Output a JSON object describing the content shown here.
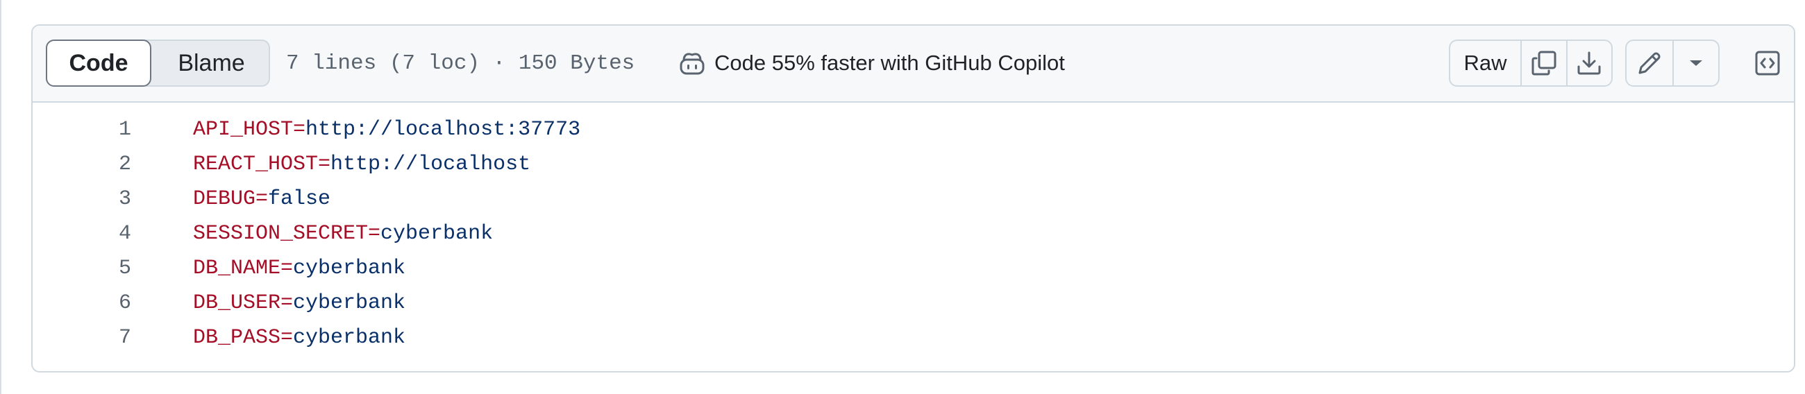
{
  "header": {
    "code_tab": "Code",
    "blame_tab": "Blame",
    "file_info": "7 lines (7 loc) · 150 Bytes",
    "copilot_promo": "Code 55% faster with GitHub Copilot",
    "raw_label": "Raw",
    "icons": [
      "copilot-icon",
      "copy-icon",
      "download-icon",
      "pencil-icon",
      "caret-down-icon",
      "code-square-icon"
    ]
  },
  "code": {
    "lines": [
      {
        "num": "1",
        "key": "API_HOST=",
        "value": "http://localhost:37773"
      },
      {
        "num": "2",
        "key": "REACT_HOST=",
        "value": "http://localhost"
      },
      {
        "num": "3",
        "key": "DEBUG=",
        "value": "false"
      },
      {
        "num": "4",
        "key": "SESSION_SECRET=",
        "value": "cyberbank"
      },
      {
        "num": "5",
        "key": "DB_NAME=",
        "value": "cyberbank"
      },
      {
        "num": "6",
        "key": "DB_USER=",
        "value": "cyberbank"
      },
      {
        "num": "7",
        "key": "DB_PASS=",
        "value": "cyberbank"
      }
    ]
  },
  "colors": {
    "key": "#a40e26",
    "value": "#0a3069",
    "line_number": "#59636e",
    "header_bg": "#f6f8fa",
    "border": "#d1d9e0"
  }
}
